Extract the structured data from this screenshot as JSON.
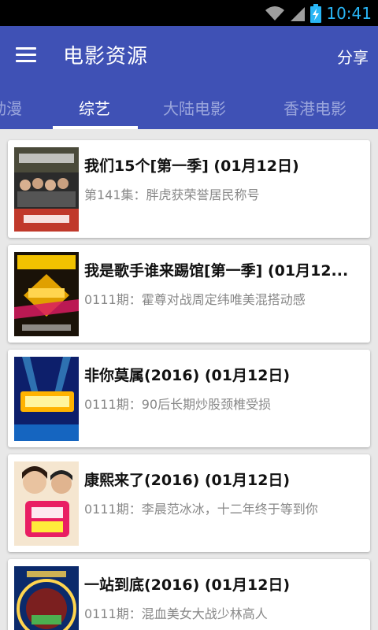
{
  "status": {
    "time": "10:41",
    "icons": [
      "wifi-icon",
      "signal-icon",
      "battery-charging-icon"
    ]
  },
  "app_bar": {
    "title": "电影资源",
    "share_label": "分享",
    "menu_icon": "menu-icon"
  },
  "tabs": [
    {
      "label": "动漫"
    },
    {
      "label": "综艺",
      "active": true
    },
    {
      "label": "大陆电影"
    },
    {
      "label": "香港电影"
    }
  ],
  "items": [
    {
      "title": "我们15个[第一季] (01月12日)",
      "subtitle": "第141集：胖虎获荣誉居民称号"
    },
    {
      "title": "我是歌手谁来踢馆[第一季] (01月12...",
      "subtitle": "0111期：霍尊对战周定纬唯美混搭动感"
    },
    {
      "title": "非你莫属(2016) (01月12日)",
      "subtitle": "0111期：90后长期炒股颈椎受损"
    },
    {
      "title": "康熙来了(2016) (01月12日)",
      "subtitle": "0111期：李晨范冰冰，十二年终于等到你"
    },
    {
      "title": "一站到底(2016) (01月12日)",
      "subtitle": "0111期：混血美女大战少林高人"
    }
  ],
  "colors": {
    "primary": "#3f51b5",
    "status_time": "#29b6f6",
    "tab_inactive": "#9aa5dc"
  }
}
